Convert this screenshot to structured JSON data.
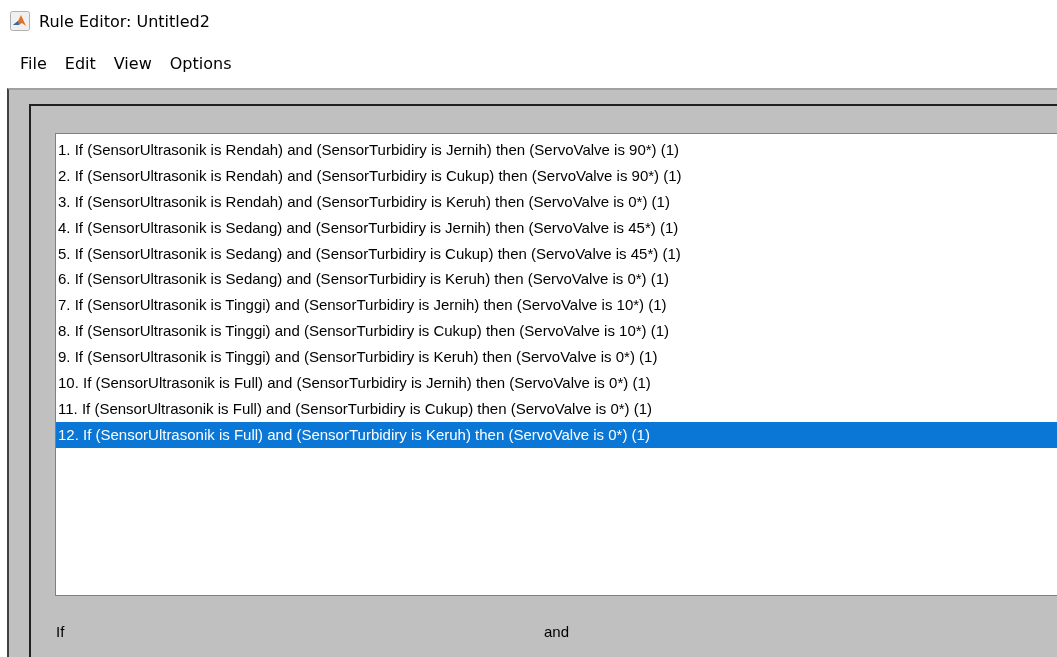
{
  "window": {
    "title": "Rule Editor: Untitled2"
  },
  "menu": [
    "File",
    "Edit",
    "View",
    "Options"
  ],
  "rules": [
    {
      "text": "1. If (SensorUltrasonik is Rendah) and (SensorTurbidiry is Jernih) then (ServoValve is 90*) (1)",
      "selected": false
    },
    {
      "text": "2. If (SensorUltrasonik is Rendah) and (SensorTurbidiry is Cukup) then (ServoValve is 90*) (1)",
      "selected": false
    },
    {
      "text": "3. If (SensorUltrasonik is Rendah) and (SensorTurbidiry is Keruh) then (ServoValve is 0*) (1)",
      "selected": false
    },
    {
      "text": "4. If (SensorUltrasonik is Sedang) and (SensorTurbidiry is Jernih) then (ServoValve is 45*) (1)",
      "selected": false
    },
    {
      "text": "5. If (SensorUltrasonik is Sedang) and (SensorTurbidiry is Cukup) then (ServoValve is 45*) (1)",
      "selected": false
    },
    {
      "text": "6. If (SensorUltrasonik is Sedang) and (SensorTurbidiry is Keruh) then (ServoValve is 0*) (1)",
      "selected": false
    },
    {
      "text": "7. If (SensorUltrasonik is Tinggi) and (SensorTurbidiry is Jernih) then (ServoValve is 10*) (1)",
      "selected": false
    },
    {
      "text": "8. If (SensorUltrasonik is Tinggi) and (SensorTurbidiry is Cukup) then (ServoValve is 10*) (1)",
      "selected": false
    },
    {
      "text": "9. If (SensorUltrasonik is Tinggi) and (SensorTurbidiry is Keruh) then (ServoValve is 0*) (1)",
      "selected": false
    },
    {
      "text": "10. If (SensorUltrasonik is Full) and (SensorTurbidiry is Jernih) then (ServoValve is 0*) (1)",
      "selected": false
    },
    {
      "text": "11. If (SensorUltrasonik is Full) and (SensorTurbidiry is Cukup) then (ServoValve is 0*) (1)",
      "selected": false
    },
    {
      "text": "12. If (SensorUltrasonik is Full) and (SensorTurbidiry is Keruh) then (ServoValve is 0*) (1)",
      "selected": true
    }
  ],
  "labels": [
    "If",
    "and"
  ]
}
